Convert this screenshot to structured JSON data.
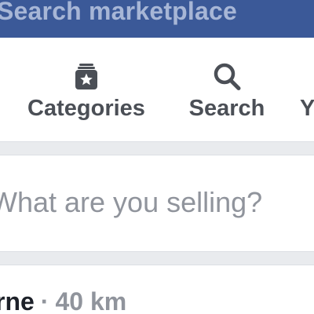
{
  "search": {
    "placeholder": "Search marketplace"
  },
  "nav": {
    "items": [
      {
        "label": "Categories",
        "icon": "categories-star-box-icon"
      },
      {
        "label": "Search",
        "icon": "magnifier-icon"
      },
      {
        "label": "Y",
        "icon": ""
      }
    ]
  },
  "sell": {
    "placeholder": "What are you selling?"
  },
  "location": {
    "name": "rne",
    "separator": "·",
    "distance": "40 km"
  },
  "colors": {
    "brand_bar": "#3b5998",
    "text_dark": "#4b4f56",
    "text_muted": "#90949c",
    "divider": "#e9ebee"
  }
}
